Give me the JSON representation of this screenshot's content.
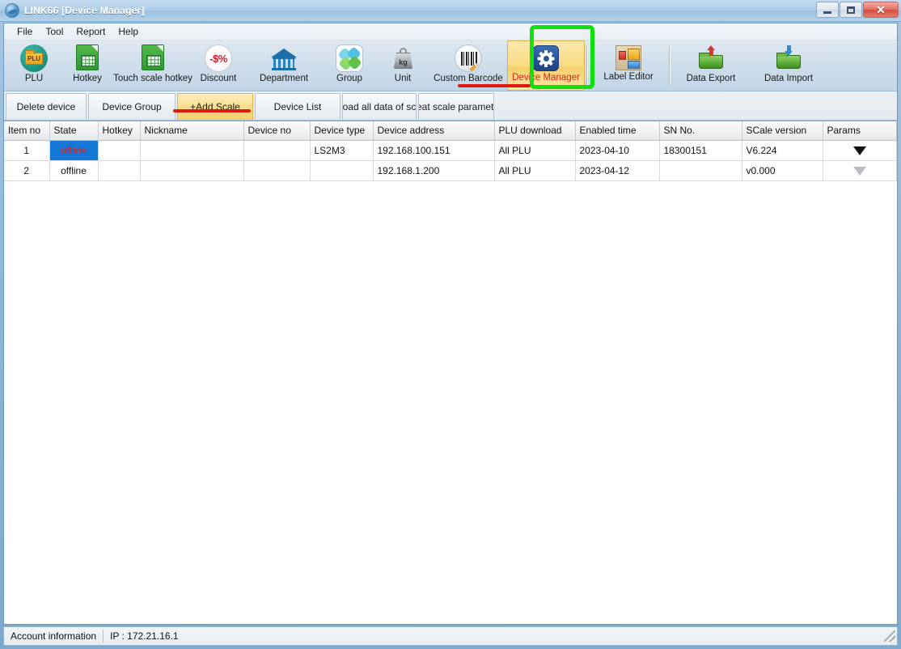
{
  "window": {
    "title": "LINK66 [Device Manager]",
    "app_icon": "globe-icon",
    "minimize_label": "",
    "maximize_label": "",
    "close_label": "✕"
  },
  "menubar": {
    "items": [
      {
        "label": "File"
      },
      {
        "label": "Tool"
      },
      {
        "label": "Report"
      },
      {
        "label": "Help"
      }
    ]
  },
  "toolbar": {
    "items": [
      {
        "label": "PLU",
        "icon": "plu-folder-icon",
        "active": false
      },
      {
        "label": "Hotkey",
        "icon": "green-sheet-icon",
        "active": false
      },
      {
        "label": "Touch scale hotkey",
        "icon": "green-sheet-icon",
        "active": false
      },
      {
        "label": "Discount",
        "icon": "discount-percent-icon",
        "active": false
      },
      {
        "label": "Department",
        "icon": "bank-building-icon",
        "active": false
      },
      {
        "label": "Group",
        "icon": "group-petals-icon",
        "active": false
      },
      {
        "label": "Unit",
        "icon": "weight-kg-icon",
        "active": false
      },
      {
        "label": "Custom Barcode",
        "icon": "barcode-pencil-icon",
        "active": false
      },
      {
        "label": "Device Manager",
        "icon": "gear-icon",
        "active": true
      },
      {
        "label": "Label Editor",
        "icon": "label-blocks-icon",
        "active": false
      },
      {
        "label": "Data Export",
        "icon": "folder-up-arrow-icon",
        "active": false
      },
      {
        "label": "Data Import",
        "icon": "folder-down-arrow-icon",
        "active": false
      }
    ]
  },
  "tabstrip": {
    "tabs": [
      {
        "label": "Delete device",
        "selected": false
      },
      {
        "label": "Device Group",
        "selected": false
      },
      {
        "label": "+Add Scale",
        "selected": true
      },
      {
        "label": "Device List",
        "selected": false
      },
      {
        "label": "pload all data of scal",
        "selected": false
      },
      {
        "label": "reat scale paramete",
        "selected": false
      }
    ]
  },
  "table": {
    "columns": [
      "Item no",
      "State",
      "Hotkey",
      "Nickname",
      "Device no",
      "Device type",
      "Device address",
      "PLU download",
      "Enabled time",
      "SN No.",
      "SCale version",
      "Params"
    ],
    "rows": [
      {
        "item_no": "1",
        "state": "offline",
        "state_selected": true,
        "hotkey": "",
        "nickname": "",
        "device_no": "",
        "device_type": "LS2M3",
        "device_address": "192.168.100.151",
        "plu_download": "All PLU",
        "enabled_time": "2023-04-10",
        "sn_no": "18300151",
        "scale_version": "V6.224",
        "params_icon": "triangle-down-icon",
        "params_enabled": true
      },
      {
        "item_no": "2",
        "state": "offline",
        "state_selected": false,
        "hotkey": "",
        "nickname": "",
        "device_no": "",
        "device_type": "",
        "device_address": "192.168.1.200",
        "plu_download": "All PLU",
        "enabled_time": "2023-04-12",
        "sn_no": "",
        "scale_version": "v0.000",
        "params_icon": "triangle-down-icon",
        "params_enabled": false
      }
    ]
  },
  "statusbar": {
    "account_label": "Account information",
    "ip_label": "IP : 172.21.16.1"
  },
  "annotations": {
    "green_box_target": "Label Editor",
    "red_underline_targets": [
      "Device Manager",
      "+Add Scale"
    ],
    "green_color": "#10e010",
    "red_color": "#e01a10"
  },
  "colors": {
    "accent_yellow": "#f4d06a",
    "selection_blue": "#1578d6",
    "offline_red": "#e02020",
    "title_blue": "#9cc0e0"
  }
}
